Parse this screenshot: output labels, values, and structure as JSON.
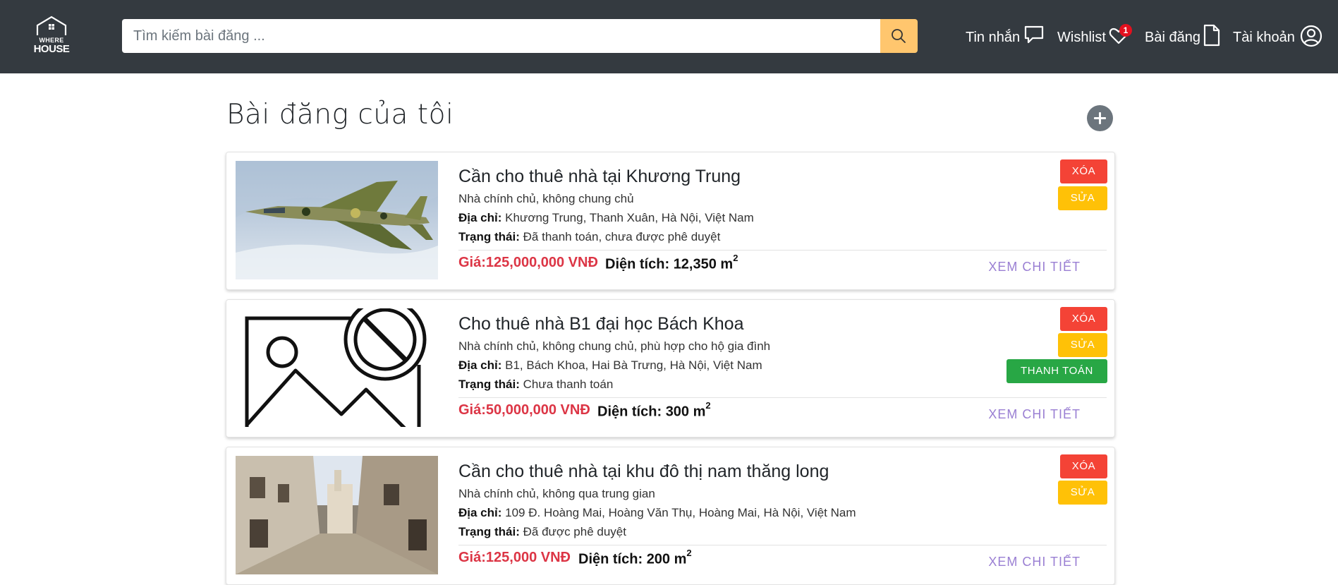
{
  "header": {
    "logo_line1": "WHERE",
    "logo_line2": "HOUSE",
    "search_placeholder": "Tìm kiếm bài đăng ...",
    "search_icon": "search-icon",
    "nav": {
      "messages": "Tin nhắn",
      "wishlist": "Wishlist",
      "wishlist_count": "1",
      "posts": "Bài đăng",
      "account": "Tài khoản"
    },
    "accent_color": "#ffc66e",
    "bg_color": "#343a40"
  },
  "main": {
    "title": "Bài đăng của tôi",
    "listings": [
      {
        "title": "Cần cho thuê nhà tại Khương Trung",
        "description": "Nhà chính chủ, không chung chủ",
        "address_label": "Địa chỉ:",
        "address": "Khương Trung, Thanh Xuân, Hà Nội, Việt Nam",
        "status_label": "Trạng thái:",
        "status": "Đã thanh toán, chưa được phê duyệt",
        "price_label": "Giá:",
        "price": "125,000,000 VNĐ",
        "area_label": "Diện tích:",
        "area": "12,350 m",
        "area_unit_sup": "2",
        "detail": "XEM CHI TIẾT",
        "actions": [
          "XÓA",
          "SỬA"
        ]
      },
      {
        "title": "Cho thuê nhà B1 đại học Bách Khoa",
        "description": "Nhà chính chủ, không chung chủ, phù hợp cho hộ gia đình",
        "address_label": "Địa chỉ:",
        "address": "B1, Bách Khoa, Hai Bà Trưng, Hà Nội, Việt Nam",
        "status_label": "Trạng thái:",
        "status": "Chưa thanh toán",
        "price_label": "Giá:",
        "price": "50,000,000 VNĐ",
        "area_label": "Diện tích:",
        "area": "300 m",
        "area_unit_sup": "2",
        "detail": "XEM CHI TIẾT",
        "actions": [
          "XÓA",
          "SỬA",
          "THANH TOÁN"
        ]
      },
      {
        "title": "Cần cho thuê nhà tại khu đô thị nam thăng long",
        "description": "Nhà chính chủ, không qua trung gian",
        "address_label": "Địa chỉ:",
        "address": "109 Đ. Hoàng Mai, Hoàng Văn Thụ, Hoàng Mai, Hà Nội, Việt Nam",
        "status_label": "Trạng thái:",
        "status": "Đã được phê duyệt",
        "price_label": "Giá:",
        "price": "125,000 VNĐ",
        "area_label": "Diện tích:",
        "area": "200 m",
        "area_unit_sup": "2",
        "detail": "XEM CHI TIẾT",
        "actions": [
          "XÓA",
          "SỬA"
        ]
      }
    ]
  }
}
